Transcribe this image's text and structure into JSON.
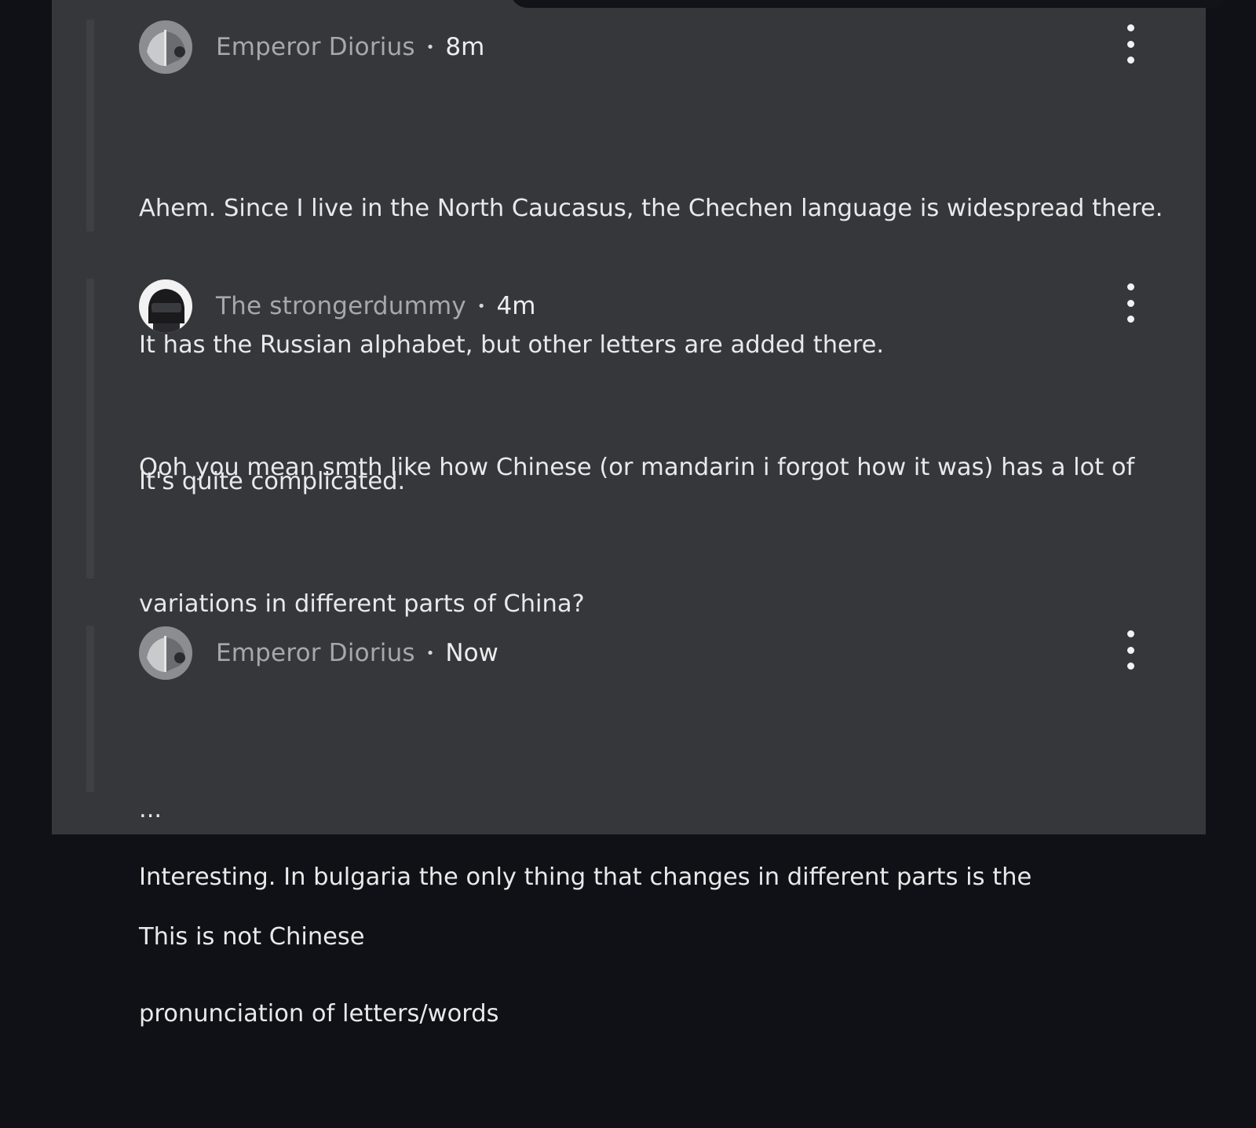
{
  "comments": [
    {
      "author": "Emperor Diorius",
      "separator": "•",
      "time": "8m",
      "avatar_icon": "penguin-avatar-icon",
      "lines": [
        "Ahem. Since I live in the North Caucasus, the Chechen language is widespread there.",
        "It has the Russian alphabet, but other letters are added there.",
        "It's quite complicated."
      ]
    },
    {
      "author": "The strongerdummy",
      "separator": "•",
      "time": "4m",
      "avatar_icon": "helmet-avatar-icon",
      "lines": [
        "Ooh you mean smth like how Chinese (or mandarin i forgot how it was) has a lot of",
        "variations in different parts of China?",
        "",
        "Interesting. In bulgaria the only thing that changes in different parts is the",
        "pronunciation of letters/words"
      ]
    },
    {
      "author": "Emperor Diorius",
      "separator": "•",
      "time": "Now",
      "avatar_icon": "penguin-avatar-icon",
      "lines": [
        "...",
        "This is not Chinese"
      ]
    }
  ]
}
